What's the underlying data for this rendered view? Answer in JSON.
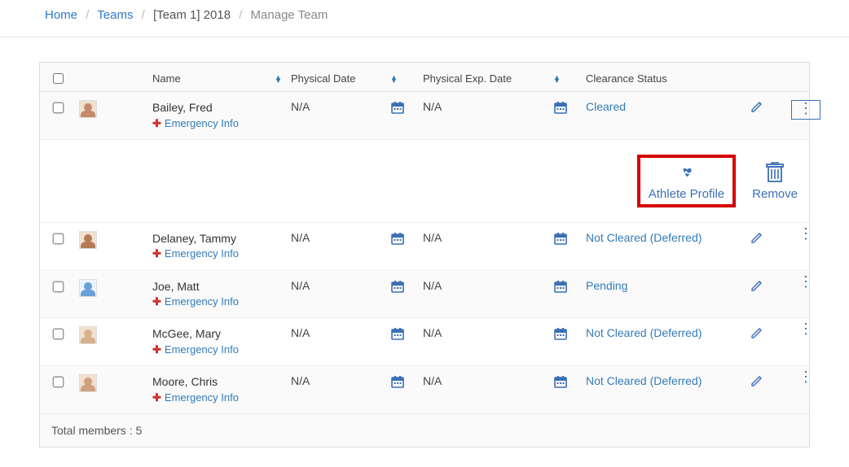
{
  "breadcrumb": {
    "home": "Home",
    "teams": "Teams",
    "team": "[Team 1] 2018",
    "current": "Manage Team"
  },
  "headers": {
    "name": "Name",
    "phys_date": "Physical Date",
    "phys_exp": "Physical Exp. Date",
    "clearance": "Clearance Status"
  },
  "emergency_label": "Emergency Info",
  "menu": {
    "athlete_profile": "Athlete Profile",
    "remove": "Remove"
  },
  "rows": [
    {
      "name": "Bailey,  Fred",
      "phys": "N/A",
      "exp": "N/A",
      "status": "Cleared",
      "expanded": true
    },
    {
      "name": "Delaney,  Tammy",
      "phys": "N/A",
      "exp": "N/A",
      "status": "Not Cleared (Deferred)",
      "expanded": false
    },
    {
      "name": "Joe,  Matt",
      "phys": "N/A",
      "exp": "N/A",
      "status": "Pending",
      "expanded": false
    },
    {
      "name": "McGee,  Mary",
      "phys": "N/A",
      "exp": "N/A",
      "status": "Not Cleared (Deferred)",
      "expanded": false
    },
    {
      "name": "Moore,  Chris",
      "phys": "N/A",
      "exp": "N/A",
      "status": "Not Cleared (Deferred)",
      "expanded": false
    }
  ],
  "footer": "Total members : 5"
}
